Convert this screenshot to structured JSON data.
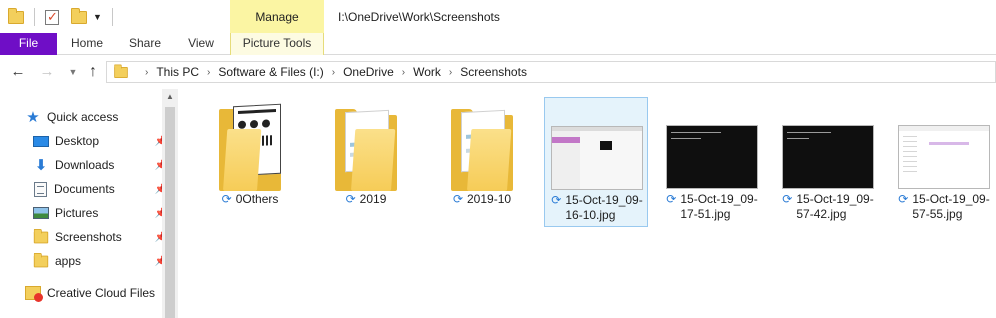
{
  "window": {
    "title": "I:\\OneDrive\\Work\\Screenshots",
    "contextual_tab_group": "Manage"
  },
  "ribbon": {
    "tabs": [
      "File",
      "Home",
      "Share",
      "View",
      "Picture Tools"
    ]
  },
  "address": {
    "crumbs": [
      "This PC",
      "Software & Files (I:)",
      "OneDrive",
      "Work",
      "Screenshots"
    ]
  },
  "navpane": {
    "quick_access": "Quick access",
    "items": [
      {
        "label": "Desktop",
        "icon": "desktop-icon",
        "pinned": true
      },
      {
        "label": "Downloads",
        "icon": "download-arrow-icon",
        "pinned": true
      },
      {
        "label": "Documents",
        "icon": "documents-icon",
        "pinned": true
      },
      {
        "label": "Pictures",
        "icon": "pictures-icon",
        "pinned": true
      },
      {
        "label": "Screenshots",
        "icon": "folder-icon",
        "pinned": true
      },
      {
        "label": "apps",
        "icon": "folder-icon",
        "pinned": true
      }
    ],
    "creative_cloud": "Creative Cloud Files"
  },
  "files": [
    {
      "line1": "0Others",
      "line2": "",
      "type": "folder"
    },
    {
      "line1": "2019",
      "line2": "",
      "type": "folder"
    },
    {
      "line1": "2019-10",
      "line2": "",
      "type": "folder"
    },
    {
      "line1": "15-Oct-19_09-",
      "line2": "16-10.jpg",
      "type": "image",
      "selected": true
    },
    {
      "line1": "15-Oct-19_09-",
      "line2": "17-51.jpg",
      "type": "image"
    },
    {
      "line1": "15-Oct-19_09-",
      "line2": "57-42.jpg",
      "type": "image"
    },
    {
      "line1": "15-Oct-19_09-",
      "line2": "57-55.jpg",
      "type": "image"
    }
  ],
  "colors": {
    "file_tab": "#6f0ec6",
    "manage_tab": "#fbf5a3",
    "selection": "#e5f3fb",
    "sync_icon": "#2a7bd5"
  }
}
